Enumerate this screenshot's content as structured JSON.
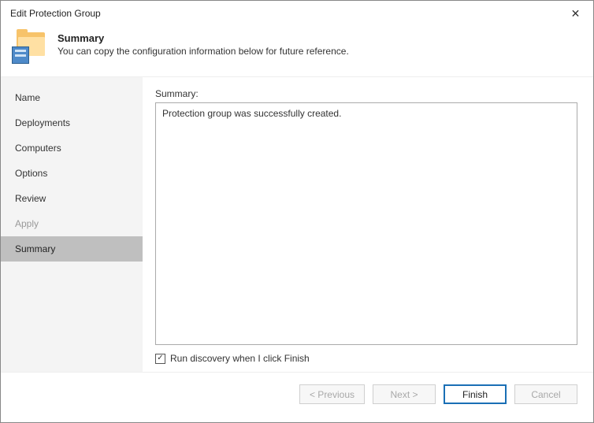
{
  "title": "Edit Protection Group",
  "header": {
    "title": "Summary",
    "subtitle": "You can copy the configuration information below for future reference."
  },
  "sidebar": {
    "items": [
      {
        "label": "Name",
        "state": "normal"
      },
      {
        "label": "Deployments",
        "state": "normal"
      },
      {
        "label": "Computers",
        "state": "normal"
      },
      {
        "label": "Options",
        "state": "normal"
      },
      {
        "label": "Review",
        "state": "normal"
      },
      {
        "label": "Apply",
        "state": "disabled"
      },
      {
        "label": "Summary",
        "state": "active"
      }
    ]
  },
  "main": {
    "summary_label": "Summary:",
    "summary_text": "Protection group was successfully created.",
    "checkbox_label": "Run discovery when I click Finish",
    "checkbox_checked": true
  },
  "footer": {
    "previous": "< Previous",
    "next": "Next >",
    "finish": "Finish",
    "cancel": "Cancel"
  }
}
